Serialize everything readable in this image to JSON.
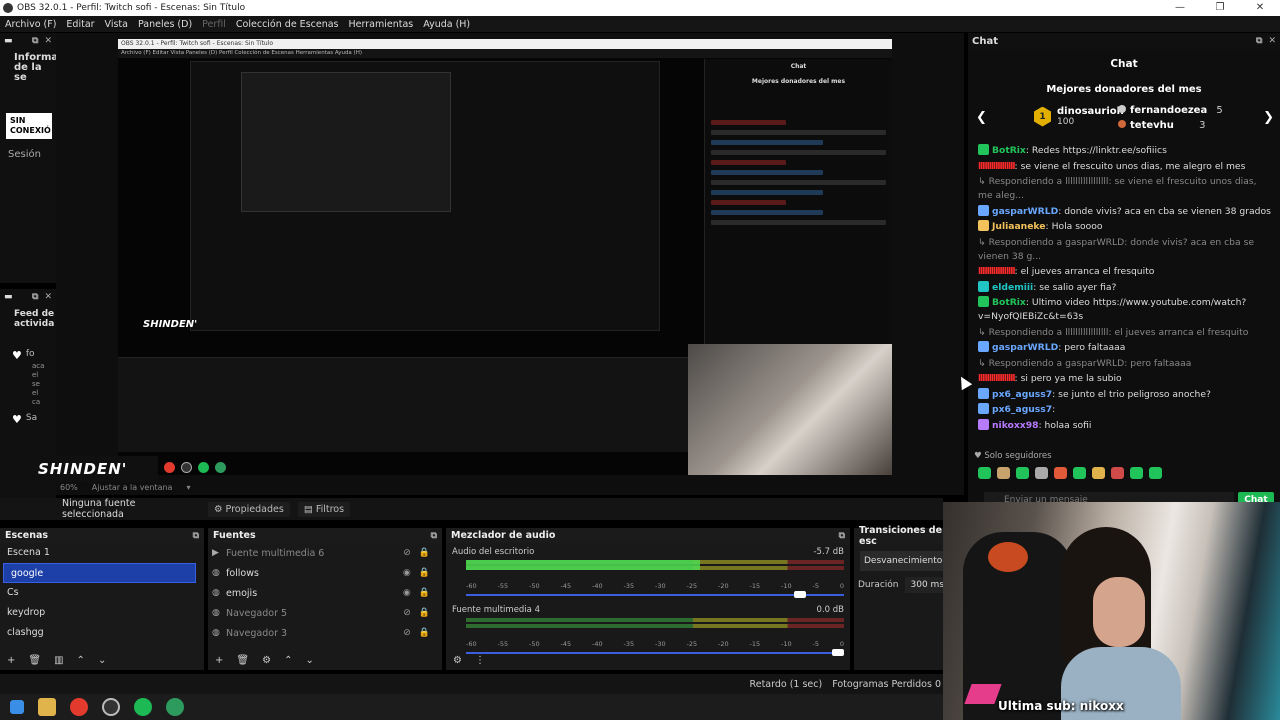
{
  "window": {
    "title": "OBS 32.0.1 - Perfil: Twitch sofi - Escenas: Sin Título",
    "controls": [
      "—",
      "❐",
      "✕"
    ]
  },
  "menu": [
    "Archivo (F)",
    "Editar",
    "Vista",
    "Paneles (D)",
    "Perfil",
    "Colección de Escenas",
    "Herramientas",
    "Ayuda (H)"
  ],
  "left_docks": {
    "info_title": "Informa de la se",
    "offline_badge": "SIN CONEXIÓ",
    "session": "Sesión",
    "feed_title": "Feed de activida",
    "feed_items": [
      "fo",
      "Sa"
    ],
    "feed_sub": [
      "aca",
      "el",
      "se",
      "el",
      "ca"
    ]
  },
  "preview": {
    "shinden": "SHINDEN'",
    "zoom": "60%",
    "fit": "Ajustar a la ventana",
    "nested_title": "OBS 32.0.1 - Perfil: Twitch sofi - Escenas: Sin Título",
    "nested_menu": "Archivo (F)  Editar  Vista  Paneles (D)  Perfil  Colección de Escenas  Herramientas  Ayuda (H)",
    "nested_chat": "Chat",
    "nested_donors": "Mejores donadores del mes"
  },
  "toolbar": {
    "no_source": "Ninguna fuente seleccionada",
    "properties": "Propiedades",
    "filters": "Filtros"
  },
  "scenes": {
    "title": "Escenas",
    "items": [
      "Escena 1",
      "google",
      "Cs",
      "keydrop",
      "clashgg"
    ],
    "selected": "google"
  },
  "sources": {
    "title": "Fuentes",
    "items": [
      {
        "label": "Fuente multimedia 6",
        "icon": "play-icon",
        "visible": false
      },
      {
        "label": "follows",
        "icon": "globe-icon",
        "visible": true
      },
      {
        "label": "emojis",
        "icon": "globe-icon",
        "visible": true
      },
      {
        "label": "Navegador 5",
        "icon": "globe-icon",
        "visible": false
      },
      {
        "label": "Navegador 3",
        "icon": "globe-icon",
        "visible": false
      }
    ]
  },
  "mixer": {
    "title": "Mezclador de audio",
    "channels": [
      {
        "name": "Audio del escritorio",
        "db": "-5.7 dB",
        "level": 0.62,
        "volume": 0.9
      },
      {
        "name": "Fuente multimedia 4",
        "db": "0.0 dB",
        "level": 0.0,
        "volume": 1.0
      }
    ],
    "ticks": [
      "-60",
      "-55",
      "-50",
      "-45",
      "-40",
      "-35",
      "-30",
      "-25",
      "-20",
      "-15",
      "-10",
      "-5",
      "0"
    ]
  },
  "transitions": {
    "title": "Transiciones de esc",
    "type": "Desvanecimiento",
    "duration_label": "Duración",
    "duration": "300 ms"
  },
  "status": {
    "delay": "Retardo (1 sec)",
    "dropped": "Fotogramas Perdidos 0"
  },
  "chat": {
    "dock_title": "Chat",
    "title": "Chat",
    "donors_title": "Mejores donadores del mes",
    "donor1": {
      "rank": "1",
      "name": "dinosaurioh",
      "amount": "100"
    },
    "donor2": {
      "name": "fernandoezea",
      "amount": "5"
    },
    "donor3": {
      "name": "tetevhu",
      "amount": "3"
    },
    "messages": [
      {
        "kind": "msg",
        "user": "BotRix",
        "color": "#21c45b",
        "text": "Redes https://linktr.ee/sofiiics"
      },
      {
        "kind": "msg",
        "user": "lllllllllllllllll",
        "color": "#ff2b2b",
        "text": "se viene el frescuito unos dias, me alegro el mes"
      },
      {
        "kind": "reply",
        "text": "Respondiendo a lllllllllllllllll: se viene el frescuito unos dias, me aleg..."
      },
      {
        "kind": "msg",
        "user": "gasparWRLD",
        "color": "#6aa7ff",
        "text": "donde vivis? aca en cba se vienen 38 grados"
      },
      {
        "kind": "msg",
        "user": "Juliaaneke",
        "color": "#f3c25b",
        "text": "Hola soooo"
      },
      {
        "kind": "reply",
        "text": "Respondiendo a gasparWRLD: donde vivis? aca en cba se vienen 38 g..."
      },
      {
        "kind": "msg",
        "user": "lllllllllllllllll",
        "color": "#ff2b2b",
        "text": "el jueves arranca el fresquito"
      },
      {
        "kind": "msg",
        "user": "eldemiii",
        "color": "#21c4c4",
        "text": "se salio ayer fia?"
      },
      {
        "kind": "msg",
        "user": "BotRix",
        "color": "#21c45b",
        "text": "Ultimo video https://www.youtube.com/watch?v=NyofQIEBiZc&t=63s"
      },
      {
        "kind": "reply",
        "text": "Respondiendo a lllllllllllllllll: el jueves arranca el fresquito"
      },
      {
        "kind": "msg",
        "user": "gasparWRLD",
        "color": "#6aa7ff",
        "text": "pero faltaaaa"
      },
      {
        "kind": "reply",
        "text": "Respondiendo a gasparWRLD: pero faltaaaa"
      },
      {
        "kind": "msg",
        "user": "lllllllllllllllll",
        "color": "#ff2b2b",
        "text": "si pero ya me la subio"
      },
      {
        "kind": "msg",
        "user": "px6_aguss7",
        "color": "#6aa7ff",
        "text": "se junto el trio peligroso anoche?"
      },
      {
        "kind": "msg",
        "user": "px6_aguss7",
        "color": "#6aa7ff",
        "text": ""
      },
      {
        "kind": "msg",
        "user": "nikoxx98",
        "color": "#b77bff",
        "text": "holaa sofii"
      }
    ],
    "followers_only": "Solo seguidores",
    "input_placeholder": "Enviar un mensaje",
    "send": "Chat"
  },
  "webcam": {
    "subtitle": "Ultima sub: nikoxx"
  }
}
